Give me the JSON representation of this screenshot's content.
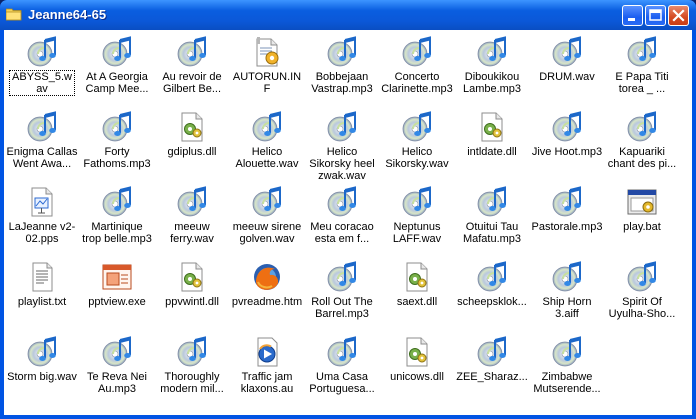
{
  "window": {
    "title": "Jeanne64-65",
    "buttons": [
      "minimize",
      "maximize",
      "close"
    ]
  },
  "colors": {
    "titlebar": "#0a5ee0",
    "client_bg": "#ffffff",
    "frame": "#0054e3"
  },
  "files": [
    {
      "name": "ABYSS_5.wav",
      "icon": "music-file-icon"
    },
    {
      "name": "At A Georgia Camp Mee...",
      "icon": "music-file-icon"
    },
    {
      "name": "Au revoir de Gilbert Be...",
      "icon": "music-file-icon"
    },
    {
      "name": "AUTORUN.INF",
      "icon": "setup-info-icon"
    },
    {
      "name": "Bobbejaan Vastrap.mp3",
      "icon": "music-file-icon"
    },
    {
      "name": "Concerto Clarinette.mp3",
      "icon": "music-file-icon"
    },
    {
      "name": "Diboukikou Lambe.mp3",
      "icon": "music-file-icon"
    },
    {
      "name": "DRUM.wav",
      "icon": "music-file-icon"
    },
    {
      "name": "E Papa Titi torea _ ...",
      "icon": "music-file-icon"
    },
    {
      "name": "Enigma Callas Went Awa...",
      "icon": "music-file-icon"
    },
    {
      "name": "Forty Fathoms.mp3",
      "icon": "music-file-icon"
    },
    {
      "name": "gdiplus.dll",
      "icon": "dll-file-icon"
    },
    {
      "name": "Helico Alouette.wav",
      "icon": "music-file-icon"
    },
    {
      "name": "Helico Sikorsky heel zwak.wav",
      "icon": "music-file-icon"
    },
    {
      "name": "Helico Sikorsky.wav",
      "icon": "music-file-icon"
    },
    {
      "name": "intldate.dll",
      "icon": "dll-file-icon"
    },
    {
      "name": "Jive Hoot.mp3",
      "icon": "music-file-icon"
    },
    {
      "name": "Kapuariki chant des pi...",
      "icon": "music-file-icon"
    },
    {
      "name": "LaJeanne v2-02.pps",
      "icon": "slideshow-file-icon"
    },
    {
      "name": "Martinique trop belle.mp3",
      "icon": "music-file-icon"
    },
    {
      "name": "meeuw ferry.wav",
      "icon": "music-file-icon"
    },
    {
      "name": "meeuw sirene golven.wav",
      "icon": "music-file-icon"
    },
    {
      "name": "Meu coracao esta em f...",
      "icon": "music-file-icon"
    },
    {
      "name": "Neptunus LAFF.wav",
      "icon": "music-file-icon"
    },
    {
      "name": "Otuitui Tau Mafatu.mp3",
      "icon": "music-file-icon"
    },
    {
      "name": "Pastorale.mp3",
      "icon": "music-file-icon"
    },
    {
      "name": "play.bat",
      "icon": "batch-file-icon"
    },
    {
      "name": "playlist.txt",
      "icon": "text-file-icon"
    },
    {
      "name": "pptview.exe",
      "icon": "powerpoint-viewer-icon"
    },
    {
      "name": "ppvwintl.dll",
      "icon": "dll-file-icon"
    },
    {
      "name": "pvreadme.htm",
      "icon": "firefox-html-icon"
    },
    {
      "name": "Roll Out The Barrel.mp3",
      "icon": "music-file-icon"
    },
    {
      "name": "saext.dll",
      "icon": "dll-file-icon"
    },
    {
      "name": "scheepsklok...",
      "icon": "music-file-icon"
    },
    {
      "name": "Ship Horn 3.aiff",
      "icon": "music-file-icon"
    },
    {
      "name": "Spirit Of Uyulha-Sho...",
      "icon": "music-file-icon"
    },
    {
      "name": "Storm big.wav",
      "icon": "music-file-icon"
    },
    {
      "name": "Te Reva Nei Au.mp3",
      "icon": "music-file-icon"
    },
    {
      "name": "Thoroughly modern mil...",
      "icon": "music-file-icon"
    },
    {
      "name": "Traffic jam klaxons.au",
      "icon": "media-player-icon"
    },
    {
      "name": "Uma Casa Portuguesa...",
      "icon": "music-file-icon"
    },
    {
      "name": "unicows.dll",
      "icon": "dll-file-icon"
    },
    {
      "name": "ZEE_Sharaz...",
      "icon": "music-file-icon"
    },
    {
      "name": "Zimbabwe Mutserende...",
      "icon": "music-file-icon"
    }
  ]
}
